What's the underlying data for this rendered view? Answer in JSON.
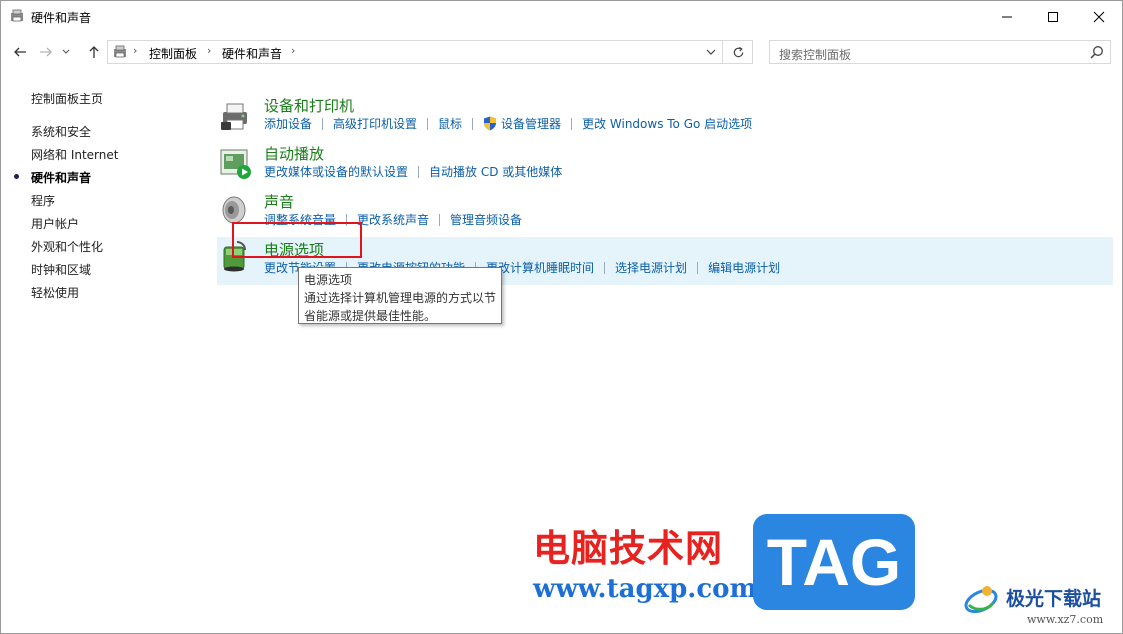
{
  "window": {
    "title": "硬件和声音",
    "controls": {
      "minimize": "minimize-icon",
      "maximize": "maximize-icon",
      "close": "close-icon"
    }
  },
  "address_bar": {
    "breadcrumb": [
      "控制面板",
      "硬件和声音"
    ],
    "search_placeholder": "搜索控制面板"
  },
  "sidebar": {
    "home": "控制面板主页",
    "items": [
      {
        "label": "系统和安全"
      },
      {
        "label": "网络和 Internet"
      },
      {
        "label": "硬件和声音",
        "active": true
      },
      {
        "label": "程序"
      },
      {
        "label": "用户帐户"
      },
      {
        "label": "外观和个性化"
      },
      {
        "label": "时钟和区域"
      },
      {
        "label": "轻松使用"
      }
    ]
  },
  "categories": [
    {
      "title": "设备和打印机",
      "icon": "printer-icon",
      "links": [
        "添加设备",
        "高级打印机设置",
        "鼠标",
        "设备管理器",
        "更改 Windows To Go 启动选项"
      ]
    },
    {
      "title": "自动播放",
      "icon": "autoplay-icon",
      "links": [
        "更改媒体或设备的默认设置",
        "自动播放 CD 或其他媒体"
      ]
    },
    {
      "title": "声音",
      "icon": "speaker-icon",
      "links": [
        "调整系统音量",
        "更改系统声音",
        "管理音频设备"
      ]
    },
    {
      "title": "电源选项",
      "icon": "power-options-icon",
      "links": [
        "更改节能设置",
        "更改电源按钮的功能",
        "更改计算机睡眠时间",
        "选择电源计划",
        "编辑电源计划"
      ]
    }
  ],
  "tooltip": {
    "title": "电源选项",
    "line1": "通过选择计算机管理电源的方式以节",
    "line2": "省能源或提供最佳性能。"
  },
  "watermark": {
    "cn": "电脑技术网",
    "url": "www.tagxp.com",
    "tag": "TAG",
    "site": "极光下载站",
    "site_url": "www.xz7.com"
  },
  "colors": {
    "category_title": "#1a7e1a",
    "link": "#0b5fa8",
    "hover_bg": "#e5f3fb",
    "highlight_box": "#e0151b"
  }
}
